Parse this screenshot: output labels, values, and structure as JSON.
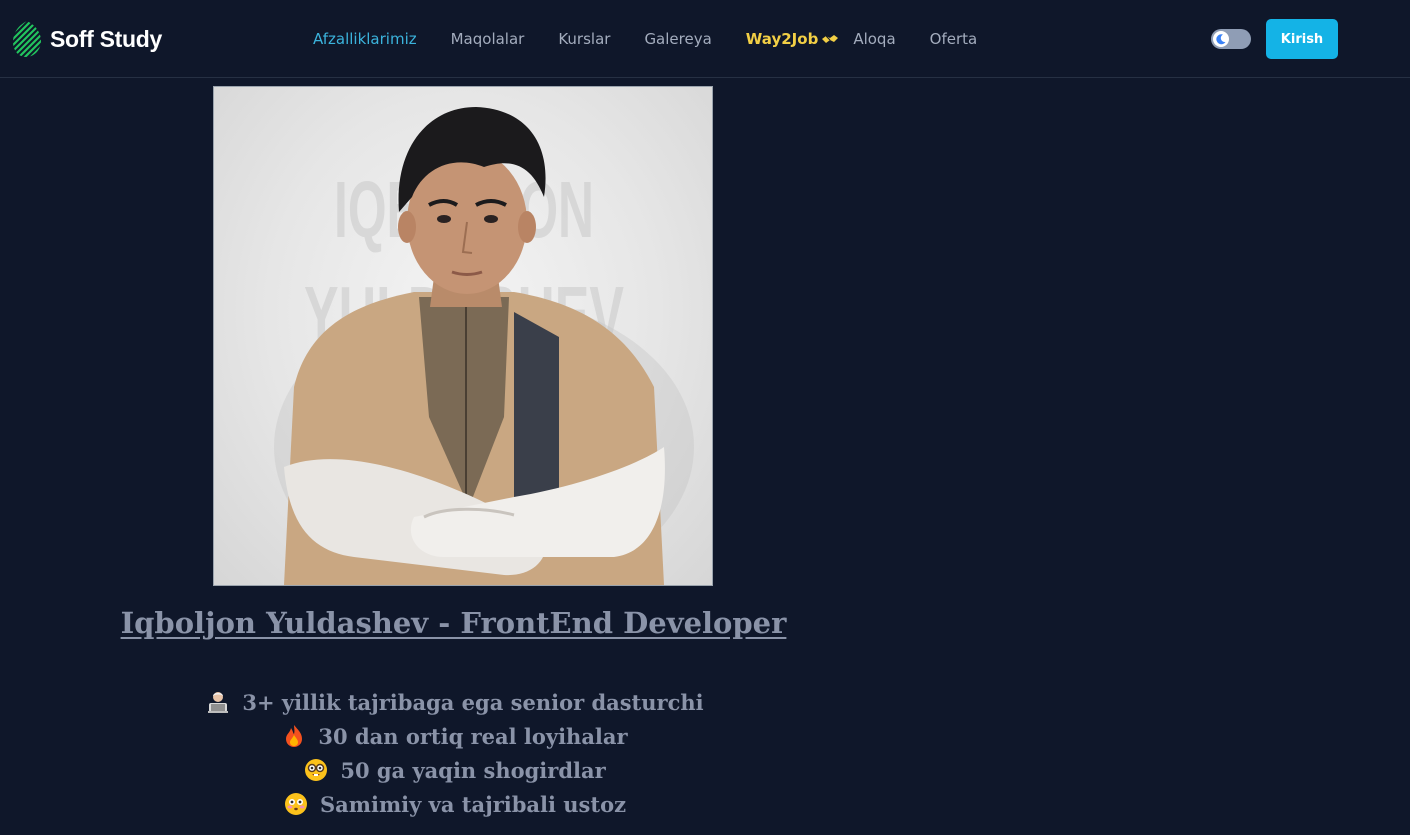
{
  "brand": {
    "name": "Soff Study",
    "accent_color": "#22c55e",
    "logo_icon": "striped-leaf-logo-icon"
  },
  "nav": {
    "items": [
      {
        "label": "Afzalliklarimiz",
        "active": true
      },
      {
        "label": "Maqolalar"
      },
      {
        "label": "Kurslar"
      },
      {
        "label": "Galereya"
      },
      {
        "label": "Way2Job",
        "highlight_color": "#f2cf45",
        "icon": "handshake-icon"
      },
      {
        "label": "Aloqa"
      },
      {
        "label": "Oferta"
      }
    ],
    "active_color": "#3bb3dc",
    "theme_toggle_icon": "moon-icon",
    "login_label": "Kirish",
    "login_color": "#14b3e6"
  },
  "profile": {
    "photo_background_text": "IQBOLJON YULDASHEV",
    "title": "Iqboljon Yuldashev - FrontEnd Developer",
    "features": [
      {
        "icon": "technologist-icon",
        "text": "3+ yillik tajribaga ega senior dasturchi"
      },
      {
        "icon": "fire-icon",
        "text": "30 dan ortiq real loyihalar"
      },
      {
        "icon": "nerd-face-icon",
        "text": "50 ga yaqin shogirdlar"
      },
      {
        "icon": "flushed-face-icon",
        "text": "Samimiy va tajribali ustoz"
      }
    ]
  },
  "colors": {
    "background": "#0f172a",
    "text_muted": "#8a93a8"
  }
}
